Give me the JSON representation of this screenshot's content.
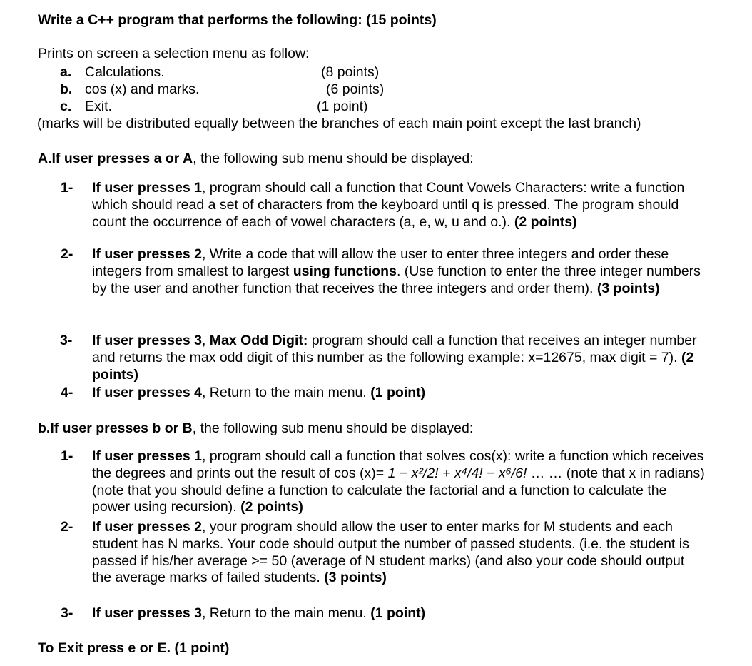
{
  "document": {
    "title_text": "Write a C++ program that performs the following: (15 points)",
    "intro_text": "Prints on screen a selection menu as follow:",
    "note_text": "(marks will be distributed equally between the branches of each main point except the last branch)",
    "closing_text": "To Exit press e or E. (1 point)"
  },
  "menu": {
    "rows": [
      {
        "letter": "a.",
        "text": "Calculations.",
        "points": "(8 points)"
      },
      {
        "letter": "b.",
        "text": "cos (x) and marks.",
        "points": "(6 points)"
      },
      {
        "letter": "c.",
        "text": "Exit.",
        "points": "(1 point)"
      }
    ]
  },
  "section_a": {
    "header_bold": "A.If user presses a or A",
    "header_rest": ", the following sub menu should be displayed:",
    "items": [
      {
        "marker": "1-",
        "bold_lead": "If user presses 1",
        "body": ", program should call a function that Count Vowels Characters: write a function which should read a set of characters from the keyboard until q is pressed. The program should count the occurrence of each of vowel characters (a, e, w, u and o.). ",
        "points": "(2 points)"
      },
      {
        "marker": "2-",
        "bold_lead": "If user presses 2",
        "body_part1": ", Write a code that will allow the user to enter three integers and order these integers from smallest to largest ",
        "bold_mid": "using functions",
        "body_part2": ". (Use function to enter the three integer numbers by the user and another function that receives the three integers and order them). ",
        "points": "(3 points)"
      },
      {
        "marker": "3-",
        "bold_lead": "If user presses 3",
        "comma": ", ",
        "bold_mid": "Max Odd Digit:",
        "body": " program should call a function that receives an integer number and returns the max odd digit of this number as the following example: x=12675, max digit = 7). ",
        "points": "(2 points)"
      },
      {
        "marker": "4-",
        "bold_lead": "If user presses 4",
        "body": ", Return to the main menu. ",
        "points": "(1 point)"
      }
    ]
  },
  "section_b": {
    "header_bold": "b.If user presses b or B",
    "header_rest": ", the following sub menu should be displayed:",
    "items": [
      {
        "marker": "1-",
        "bold_lead": "If user presses 1",
        "body_part1": ", program should call a function that solves cos(x): write a function which receives the degrees and prints out the result of cos (x)= ",
        "formula": "1 − x²/2! + x⁴/4! − x⁶/6!",
        "body_part2": " …  … (note that x in radians) (note that you should define a function to calculate the factorial and a function to calculate the power using recursion). ",
        "points": "(2 points)"
      },
      {
        "marker": "2-",
        "bold_lead": "If user presses 2",
        "body": ", your program should allow the user to enter marks for M students and each student has N marks. Your code should output the number of passed students. (i.e. the student is passed if his/her average >= 50 (average of N student marks) (and also your code should output the average marks of failed students. ",
        "points": "(3 points)"
      },
      {
        "marker": "3-",
        "bold_lead": "If user presses 3",
        "body": ", Return to the main menu. ",
        "points": "(1 point)"
      }
    ]
  }
}
